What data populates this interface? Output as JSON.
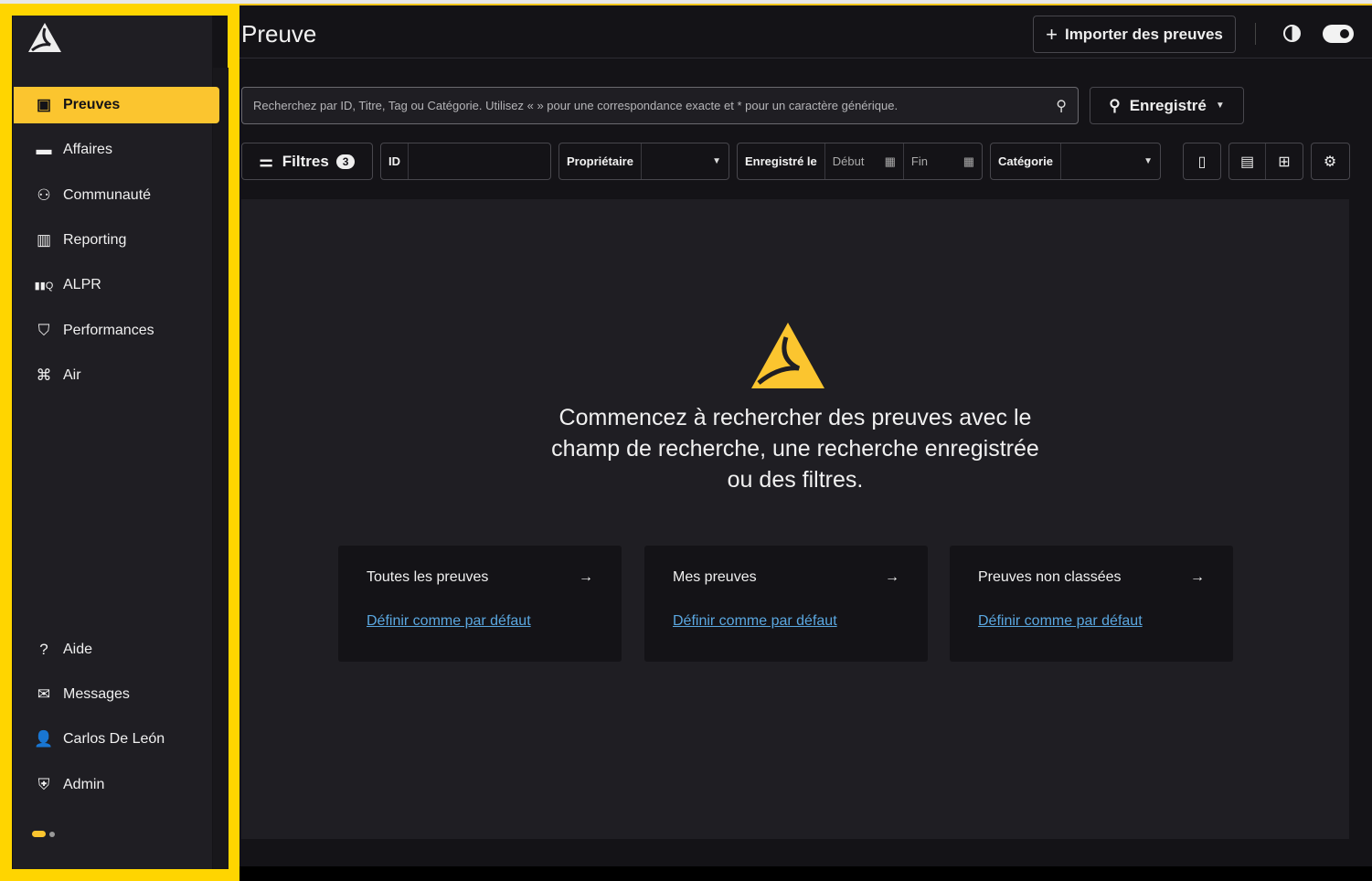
{
  "header": {
    "title": "Preuve",
    "import_label": "Importer des preuves"
  },
  "sidebar": {
    "items": [
      {
        "label": "Preuves",
        "icon": "evidence-icon"
      },
      {
        "label": "Affaires",
        "icon": "folder-icon"
      },
      {
        "label": "Communauté",
        "icon": "community-icon"
      },
      {
        "label": "Reporting",
        "icon": "chart-icon"
      },
      {
        "label": "ALPR",
        "icon": "plate-search-icon"
      },
      {
        "label": "Performances",
        "icon": "shield-chart-icon"
      },
      {
        "label": "Air",
        "icon": "drone-icon"
      }
    ],
    "bottom": [
      {
        "label": "Aide",
        "icon": "help-icon"
      },
      {
        "label": "Messages",
        "icon": "mail-icon"
      },
      {
        "label": "Carlos De León",
        "icon": "user-badge-icon"
      },
      {
        "label": "Admin",
        "icon": "admin-shield-icon"
      }
    ]
  },
  "search": {
    "placeholder": "Recherchez par ID, Titre, Tag ou Catégorie. Utilisez « » pour une correspondance exacte et * pour un caractère générique.",
    "saved_label": "Enregistré"
  },
  "filters": {
    "label": "Filtres",
    "count": "3",
    "id_label": "ID",
    "owner_label": "Propriétaire",
    "recorded_label": "Enregistré le",
    "start_placeholder": "Début",
    "end_placeholder": "Fin",
    "category_label": "Catégorie"
  },
  "empty": {
    "message": "Commencez à rechercher des preuves avec le champ de recherche, une recherche enregistrée ou des filtres."
  },
  "cards": [
    {
      "title": "Toutes les preuves",
      "link": "Définir comme par défaut"
    },
    {
      "title": "Mes preuves",
      "link": "Définir comme par défaut"
    },
    {
      "title": "Preuves non classées",
      "link": "Définir comme par défaut"
    }
  ],
  "colors": {
    "accent": "#fbc52f",
    "link": "#5aa7e0",
    "frame": "#ffd500"
  }
}
